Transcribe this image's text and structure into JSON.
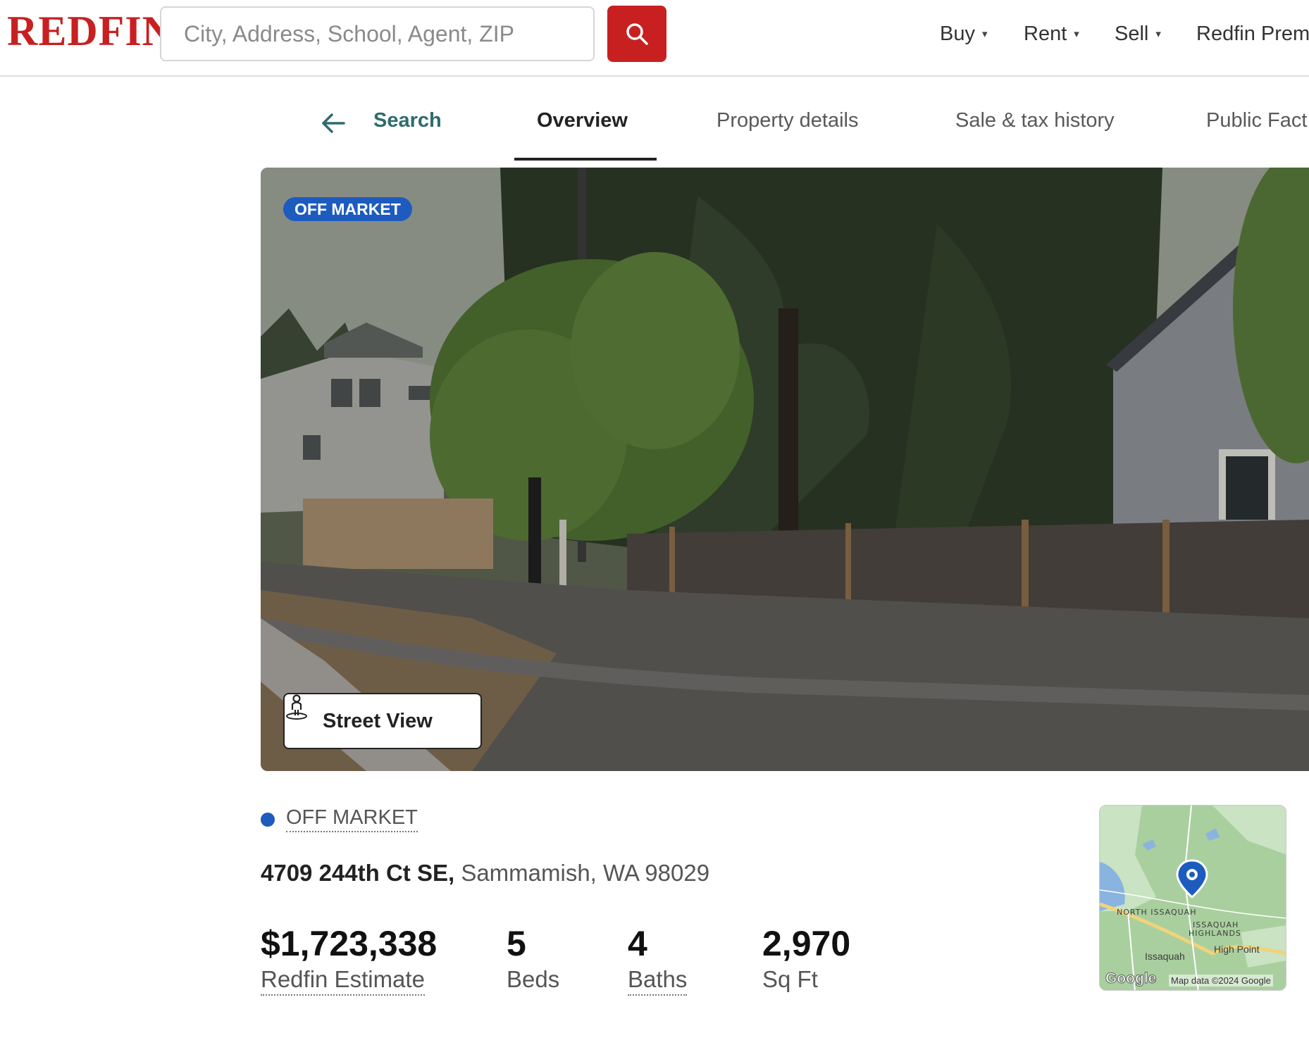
{
  "header": {
    "logo": "REDFIN",
    "search": {
      "placeholder": "City, Address, School, Agent, ZIP",
      "icon": "search-icon"
    },
    "nav": [
      {
        "label": "Buy",
        "has_dropdown": true
      },
      {
        "label": "Rent",
        "has_dropdown": true
      },
      {
        "label": "Sell",
        "has_dropdown": true
      },
      {
        "label": "Redfin Prem"
      }
    ],
    "caret": "▾"
  },
  "subnav": {
    "back_label": "Search",
    "tabs": [
      {
        "label": "Overview",
        "active": true
      },
      {
        "label": "Property details"
      },
      {
        "label": "Sale & tax history"
      },
      {
        "label": "Public Fact"
      }
    ]
  },
  "photo": {
    "badge": "OFF MARKET",
    "street_view_label": "Street View"
  },
  "listing": {
    "status": "OFF MARKET",
    "address_street": "4709 244th Ct SE,",
    "address_city": "Sammamish, WA 98029",
    "stats": [
      {
        "value": "$1,723,338",
        "label": "Redfin Estimate"
      },
      {
        "value": "5",
        "label": "Beds"
      },
      {
        "value": "4",
        "label": "Baths"
      },
      {
        "value": "2,970",
        "label": "Sq Ft"
      }
    ]
  },
  "map": {
    "labels": {
      "north_issaquah": "NORTH ISSAQUAH",
      "issaquah_highlands_1": "ISSAQUAH",
      "issaquah_highlands_2": "HIGHLANDS",
      "issaquah": "Issaquah",
      "high_point": "High Point"
    },
    "google": "Google",
    "credit": "Map data ©2024 Google"
  },
  "colors": {
    "brand_red": "#c82021",
    "badge_blue": "#1d5bbf",
    "teal_link": "#2f6b6d"
  }
}
